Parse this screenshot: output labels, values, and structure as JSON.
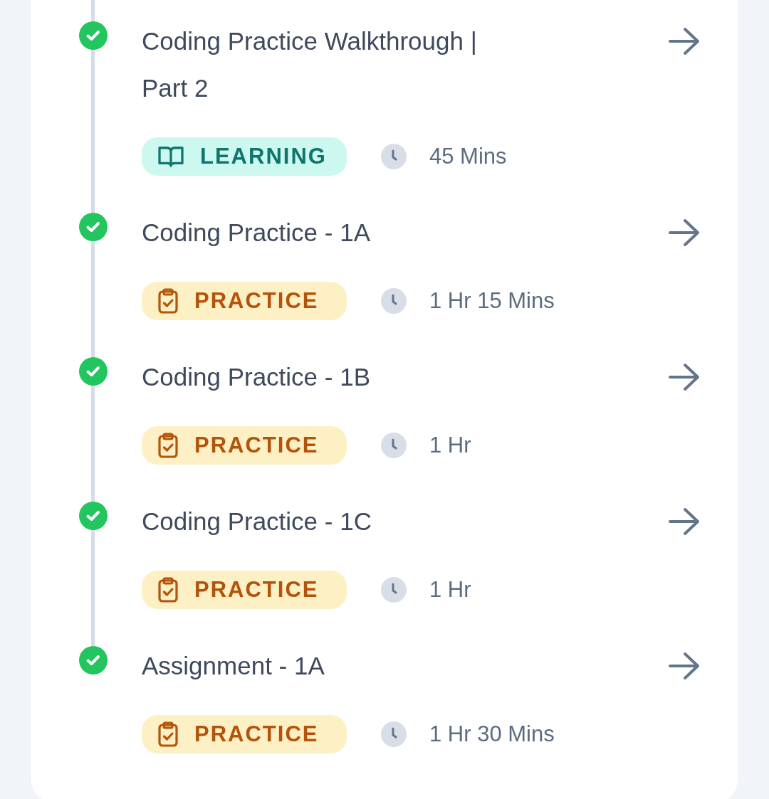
{
  "lessons": [
    {
      "title": "Coding Practice Walkthrough | Part 2",
      "completed": true,
      "tag": {
        "kind": "learning",
        "label": "LEARNING"
      },
      "duration": "45 Mins"
    },
    {
      "title": "Coding Practice - 1A",
      "completed": true,
      "tag": {
        "kind": "practice",
        "label": "PRACTICE"
      },
      "duration": "1 Hr 15 Mins"
    },
    {
      "title": "Coding Practice - 1B",
      "completed": true,
      "tag": {
        "kind": "practice",
        "label": "PRACTICE"
      },
      "duration": "1 Hr"
    },
    {
      "title": "Coding Practice - 1C",
      "completed": true,
      "tag": {
        "kind": "practice",
        "label": "PRACTICE"
      },
      "duration": "1 Hr"
    },
    {
      "title": "Assignment - 1A",
      "completed": true,
      "tag": {
        "kind": "practice",
        "label": "PRACTICE"
      },
      "duration": "1 Hr 30 Mins"
    }
  ]
}
